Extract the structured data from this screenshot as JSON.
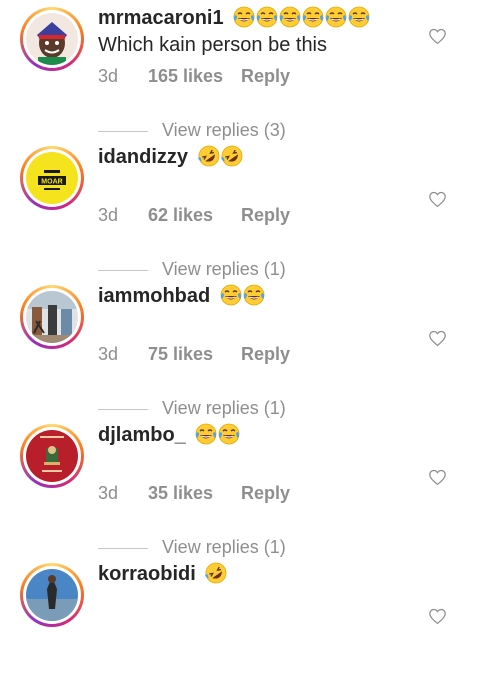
{
  "comments": [
    {
      "username": "mrmacaroni1",
      "emojis": [
        "joy",
        "joy",
        "joy",
        "joy",
        "joy",
        "joy"
      ],
      "text": "Which kain person be this",
      "time": "3d",
      "likes": "165 likes",
      "reply_label": "Reply",
      "view_replies": "View replies (3)"
    },
    {
      "username": "idandizzy",
      "emojis": [
        "rofl",
        "rofl"
      ],
      "avatar_text": "MOAR",
      "time": "3d",
      "likes": "62 likes",
      "reply_label": "Reply",
      "view_replies": "View replies (1)"
    },
    {
      "username": "iammohbad",
      "emojis": [
        "joy",
        "joy"
      ],
      "time": "3d",
      "likes": "75 likes",
      "reply_label": "Reply",
      "view_replies": "View replies (1)"
    },
    {
      "username": "djlambo_",
      "emojis": [
        "joy",
        "joy"
      ],
      "time": "3d",
      "likes": "35 likes",
      "reply_label": "Reply",
      "view_replies": "View replies (1)"
    },
    {
      "username": "korraobidi",
      "emojis": [
        "rofl"
      ]
    }
  ],
  "colors": {
    "text": "#262626",
    "secondary": "#8e8e8e",
    "divider": "#c7c7c7"
  },
  "icons": {
    "like": "heart-outline-icon",
    "joy": "face-with-tears-of-joy-icon",
    "rofl": "rolling-on-floor-laughing-icon"
  }
}
